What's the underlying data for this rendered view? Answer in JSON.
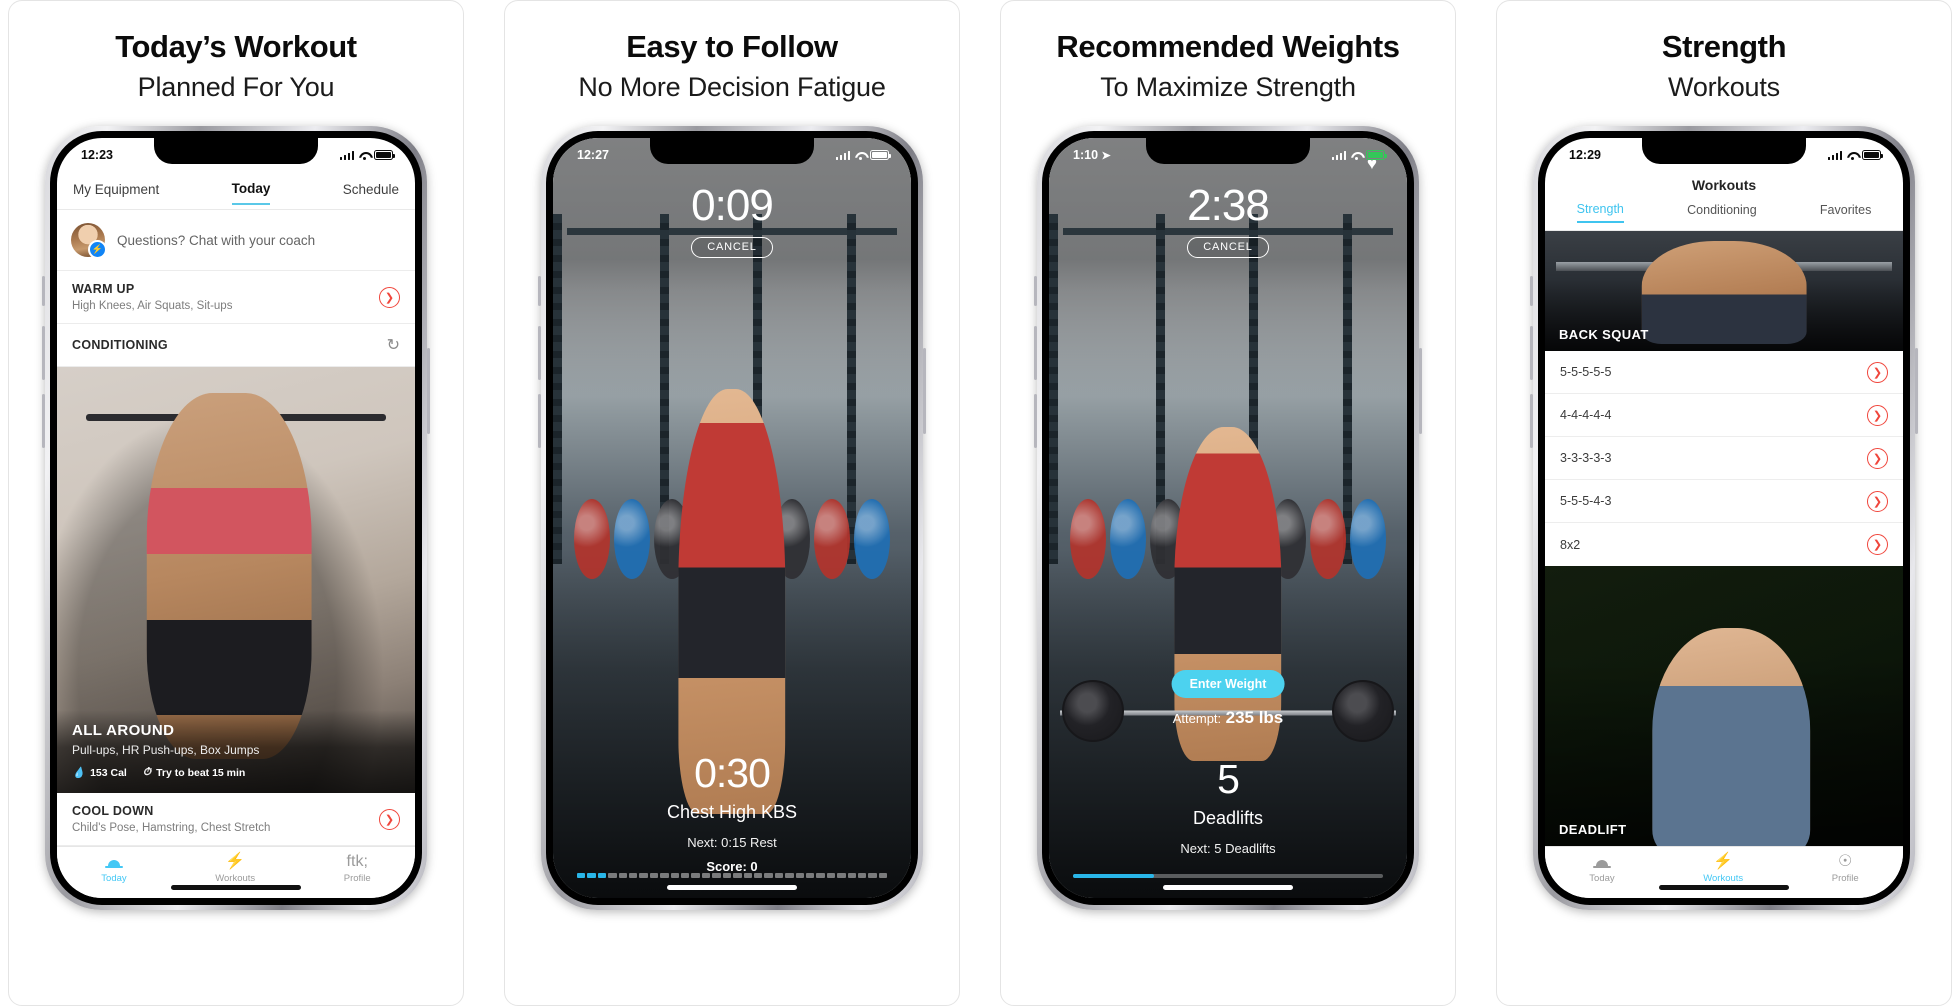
{
  "panels": [
    {
      "headline_bold": "Today’s Workout",
      "headline_light": "Planned For You",
      "phone": {
        "status": {
          "time": "12:23",
          "battery_pct": "full"
        },
        "tabs": [
          {
            "label": "My Equipment",
            "active": false
          },
          {
            "label": "Today",
            "active": true
          },
          {
            "label": "Schedule",
            "active": false
          }
        ],
        "coach_prompt": "Questions? Chat with your coach",
        "warm_up": {
          "title": "WARM UP",
          "subtitle": "High Knees, Air Squats, Sit-ups"
        },
        "conditioning": {
          "title": "CONDITIONING"
        },
        "hero": {
          "title": "ALL AROUND",
          "subtitle": "Pull-ups, HR Push-ups, Box Jumps",
          "calories": "153 Cal",
          "target_time": "Try to beat 15 min",
          "flame_icon": "🔥",
          "clock_icon": "◕"
        },
        "cool_down": {
          "title": "COOL DOWN",
          "subtitle": "Child's Pose, Hamstring, Chest Stretch"
        },
        "tabbar": [
          {
            "label": "Today",
            "icon": "sunrise-icon",
            "active": true
          },
          {
            "label": "Workouts",
            "icon": "bolt-icon",
            "active": false
          },
          {
            "label": "Profile",
            "icon": "person-icon",
            "active": false
          }
        ]
      }
    },
    {
      "headline_bold": "Easy to Follow",
      "headline_light": "No More Decision Fatigue",
      "phone": {
        "status": {
          "time": "12:27"
        },
        "timer_top": "0:09",
        "cancel_label": "CANCEL",
        "bottom_time": "0:30",
        "exercise_name": "Chest High KBS",
        "next_label": "Next: 0:15 Rest",
        "score_label": "Score: 0"
      }
    },
    {
      "headline_bold": "Recommended Weights",
      "headline_light": "To Maximize Strength",
      "phone": {
        "status": {
          "time": "1:10",
          "location_icon": "➤"
        },
        "timer_top": "2:38",
        "cancel_label": "CANCEL",
        "heart_icon": "♥",
        "enter_weight_label": "Enter Weight",
        "attempt_label": "Attempt:",
        "attempt_value": "235 lbs",
        "bottom_time": "5",
        "exercise_name": "Deadlifts",
        "next_label": "Next: 5 Deadlifts"
      }
    },
    {
      "headline_bold": "Strength",
      "headline_light": "Workouts",
      "phone": {
        "status": {
          "time": "12:29"
        },
        "nav_title": "Workouts",
        "tabs": [
          {
            "label": "Strength",
            "active": true
          },
          {
            "label": "Conditioning",
            "active": false
          },
          {
            "label": "Favorites",
            "active": false
          }
        ],
        "sections": [
          {
            "banner_label": "BACK SQUAT",
            "rows": [
              "5-5-5-5-5",
              "4-4-4-4-4",
              "3-3-3-3-3",
              "5-5-5-4-3",
              "8x2"
            ]
          },
          {
            "banner_label": "DEADLIFT",
            "rows": []
          }
        ],
        "tabbar": [
          {
            "label": "Today",
            "icon": "sunrise-icon",
            "active": false
          },
          {
            "label": "Workouts",
            "icon": "bolt-icon",
            "active": true
          },
          {
            "label": "Profile",
            "icon": "person-icon",
            "active": false
          }
        ]
      }
    }
  ],
  "colors": {
    "accent_cyan": "#44c8f5",
    "chevron_red": "#f0463c",
    "enter_weight": "#4cd2ef"
  }
}
